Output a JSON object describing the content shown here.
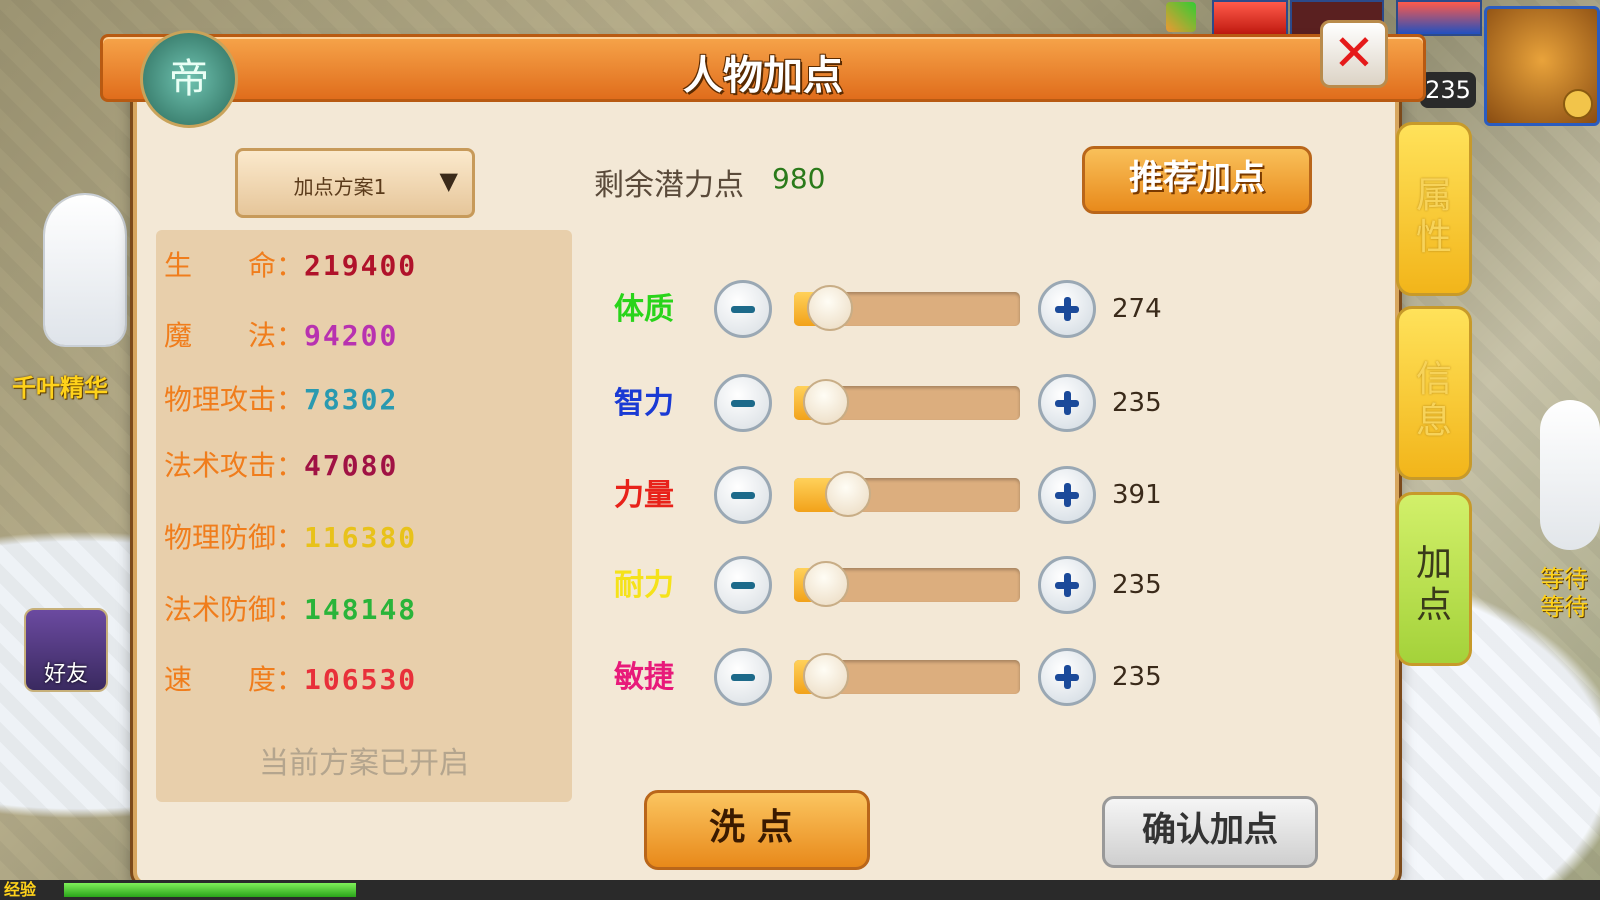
{
  "panel": {
    "title": "人物加点",
    "emblem_glyph": "帝",
    "close_symbol": "✕"
  },
  "scheme": {
    "selected": "加点方案1",
    "arrow": "▼"
  },
  "stats": [
    {
      "key": "生　　命：",
      "value": "219400",
      "color": "#b0122a"
    },
    {
      "key": "魔　　法：",
      "value": "94200",
      "color": "#b832b0"
    },
    {
      "key": "物理攻击：",
      "value": "78302",
      "color": "#2a9ab0"
    },
    {
      "key": "法术攻击：",
      "value": "47080",
      "color": "#a01244"
    },
    {
      "key": "物理防御：",
      "value": "116380",
      "color": "#e8c21a"
    },
    {
      "key": "法术防御：",
      "value": "148148",
      "color": "#2ab43a"
    },
    {
      "key": "速　　度：",
      "value": "106530",
      "color": "#e8303a"
    }
  ],
  "plan_status": "当前方案已开启",
  "remaining": {
    "label": "剩余潜力点",
    "value": "980"
  },
  "recommend_label": "推荐加点",
  "attributes": [
    {
      "name": "体质",
      "value": "274",
      "color": "#29d41a",
      "fraction": 0.16
    },
    {
      "name": "智力",
      "value": "235",
      "color": "#1a3ad4",
      "fraction": 0.14
    },
    {
      "name": "力量",
      "value": "391",
      "color": "#e8221a",
      "fraction": 0.24
    },
    {
      "name": "耐力",
      "value": "235",
      "color": "#f5e21a",
      "fraction": 0.14
    },
    {
      "name": "敏捷",
      "value": "235",
      "color": "#e81a7a",
      "fraction": 0.14
    }
  ],
  "reset_label": "洗点",
  "confirm_label": "确认加点",
  "side_tabs": [
    {
      "label": "属\n性"
    },
    {
      "label": "信\n息"
    },
    {
      "label": "加\n点"
    }
  ],
  "hud": {
    "level": "235",
    "friend_label": "好友",
    "left_character_name": "千叶精华",
    "right_status": "等待\n等待",
    "exp_label": "经验",
    "exp_fraction": 0.19
  }
}
